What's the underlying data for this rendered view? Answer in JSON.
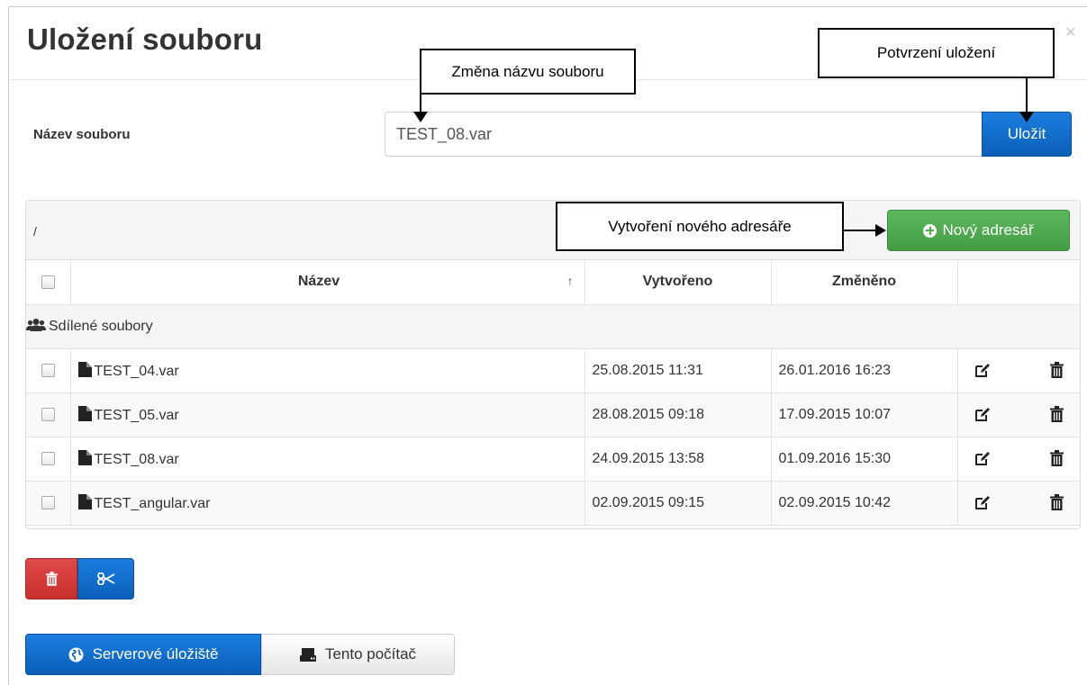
{
  "dialog": {
    "title": "Uložení souboru",
    "close": "×"
  },
  "filename": {
    "label": "Název souboru",
    "value": "TEST_08.var",
    "save_label": "Uložit"
  },
  "browser": {
    "path": "/",
    "new_dir_label": "Nový adresář",
    "columns": {
      "name": "Název",
      "sort_indicator": "↑",
      "created": "Vytvořeno",
      "changed": "Změněno"
    },
    "shared_folder": "Sdílené soubory",
    "files": [
      {
        "name": "TEST_04.var",
        "created": "25.08.2015 11:31",
        "changed": "26.01.2016 16:23"
      },
      {
        "name": "TEST_05.var",
        "created": "28.08.2015 09:18",
        "changed": "17.09.2015 10:07"
      },
      {
        "name": "TEST_08.var",
        "created": "24.09.2015 13:58",
        "changed": "01.09.2016 15:30"
      },
      {
        "name": "TEST_angular.var",
        "created": "02.09.2015 09:15",
        "changed": "02.09.2015 10:42"
      }
    ]
  },
  "storage": {
    "server_label": "Serverové úložiště",
    "local_label": "Tento počítač"
  },
  "annotations": {
    "rename": "Změna názvu souboru",
    "confirm": "Potvrzení uložení",
    "new_dir": "Vytvoření nového adresáře"
  },
  "colors": {
    "primary": "#0c5fb8",
    "success": "#5cb85c",
    "danger": "#c9302c"
  },
  "icons": {
    "close": "close-icon",
    "plus": "plus-circle-icon",
    "users": "users-icon",
    "file": "file-icon",
    "edit": "edit-icon",
    "trash": "trash-icon",
    "scissors": "scissors-icon",
    "globe": "globe-icon",
    "hdd": "hdd-icon"
  }
}
